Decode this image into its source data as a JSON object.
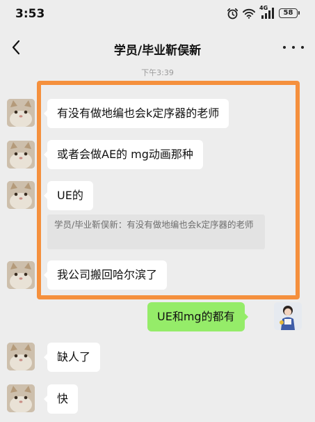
{
  "status_bar": {
    "time": "3:53",
    "network": "4G",
    "battery": "58"
  },
  "header": {
    "back_icon": "chevron-left-icon",
    "title": "学员/毕业靳俣新",
    "more_icon": "more-dots-icon"
  },
  "timestamp": "下午3:39",
  "messages": [
    {
      "side": "left",
      "text": "有没有做地编也会k定序器的老师"
    },
    {
      "side": "left",
      "text": "或者会做AE的 mg动画那种"
    },
    {
      "side": "left",
      "text": "UE的",
      "quote": "学员/毕业靳俣新：有没有做地编也会k定序器的老师"
    },
    {
      "side": "left",
      "text": "我公司搬回哈尔滨了"
    },
    {
      "side": "right",
      "text": "UE和mg的都有"
    },
    {
      "side": "left",
      "text": "缺人了"
    },
    {
      "side": "left",
      "text": "快"
    }
  ],
  "colors": {
    "background": "#ededed",
    "bubble_incoming": "#ffffff",
    "bubble_outgoing": "#95ec69",
    "highlight": "#f5903d"
  }
}
